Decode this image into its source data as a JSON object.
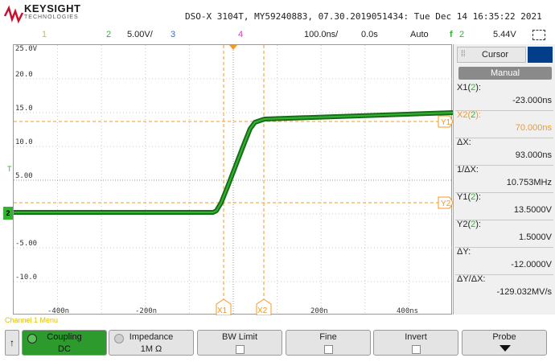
{
  "header": {
    "brand": "KEYSIGHT",
    "brand_sub": "TECHNOLOGIES",
    "device_line": "DSO-X 3104T, MY59240883, 07.30.2019051434: Tue Dec 14 16:35:22 2021"
  },
  "status": {
    "ch1": "1",
    "ch2": "2",
    "ch2_scale": "5.00V/",
    "ch3": "3",
    "ch4": "4",
    "timebase": "100.0ns/",
    "delay": "0.0s",
    "trigger_mode": "Auto",
    "trigger_icon": "f",
    "trigger_source": "2",
    "trigger_level": "5.44V"
  },
  "graticule": {
    "y_labels": [
      "25.0V",
      "20.0",
      "15.0",
      "10.0",
      "5.00",
      "-5.00",
      "-10.0"
    ],
    "x_labels": [
      "-400n",
      "-200n",
      "200n",
      "400ns"
    ],
    "cursor_tags": {
      "x1": "X1",
      "x2": "X2",
      "y1": "Y1",
      "y2": "Y2"
    },
    "ch2_marker": "2",
    "trig_marker": "T"
  },
  "cursor_panel": {
    "tab_label": "Cursor",
    "mode_button": "Manual",
    "rows": [
      {
        "label": "X1(",
        "source": "2",
        "label_end": "):",
        "value": "-23.000ns"
      },
      {
        "label": "X2(",
        "source": "2",
        "label_end": "):",
        "value": "70.000ns"
      },
      {
        "label": "ΔX:",
        "source": "",
        "label_end": "",
        "value": "93.000ns"
      },
      {
        "label": "1/ΔX:",
        "source": "",
        "label_end": "",
        "value": "10.753MHz"
      },
      {
        "label": "Y1(",
        "source": "2",
        "label_end": "):",
        "value": "13.5000V"
      },
      {
        "label": "Y2(",
        "source": "2",
        "label_end": "):",
        "value": "1.5000V"
      },
      {
        "label": "ΔY:",
        "source": "",
        "label_end": "",
        "value": "-12.0000V"
      },
      {
        "label": "ΔY/ΔX:",
        "source": "",
        "label_end": "",
        "value": "-129.032MV/s"
      }
    ]
  },
  "softkeys": {
    "menu_title": "Channel 1 Menu",
    "back": "↑",
    "keys": [
      {
        "label": "Coupling",
        "value": "DC"
      },
      {
        "label": "Impedance",
        "value": "1M Ω"
      },
      {
        "label": "BW Limit",
        "value": ""
      },
      {
        "label": "Fine",
        "value": ""
      },
      {
        "label": "Invert",
        "value": ""
      },
      {
        "label": "Probe",
        "value": ""
      }
    ]
  },
  "colors": {
    "ch1": "#e0c000",
    "ch2": "#2fb52f",
    "ch3": "#3b6cc7",
    "ch4": "#d33cbf",
    "cursor": "#f39a21",
    "brand_blue": "#003e8a"
  }
}
